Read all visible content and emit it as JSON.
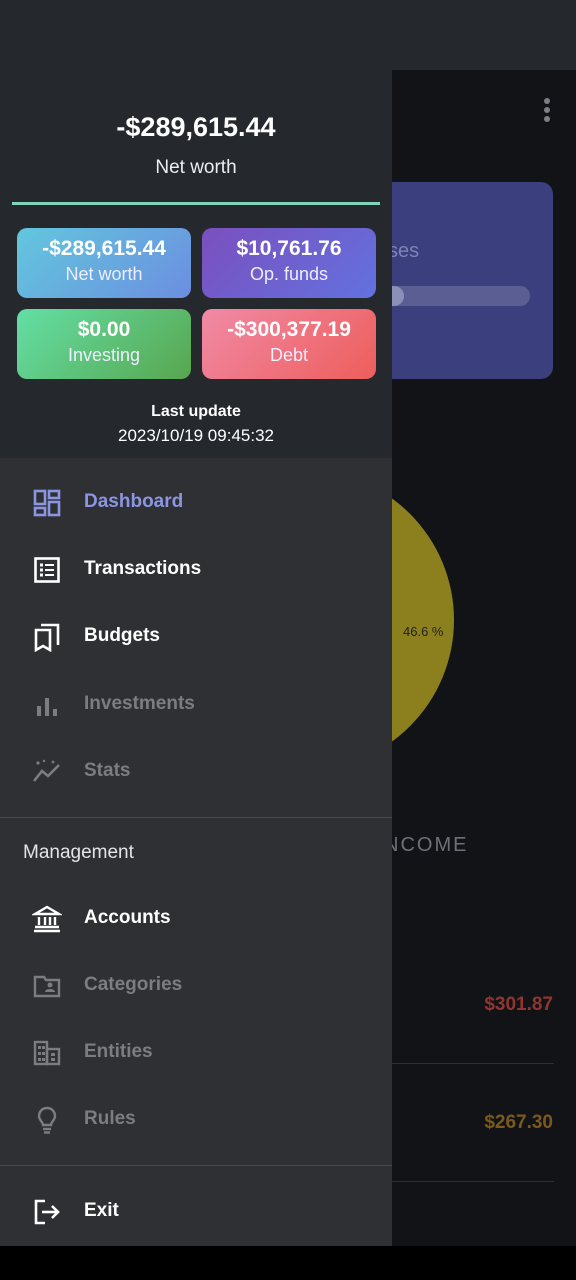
{
  "header": {
    "net_worth_value": "-$289,615.44",
    "net_worth_label": "Net worth",
    "tiles": [
      {
        "value": "-$289,615.44",
        "label": "Net worth"
      },
      {
        "value": "$10,761.76",
        "label": "Op. funds"
      },
      {
        "value": "$0.00",
        "label": "Investing"
      },
      {
        "value": "-$300,377.19",
        "label": "Debt"
      }
    ],
    "last_update_label": "Last update",
    "last_update_time": "2023/10/19 09:45:32"
  },
  "menu": {
    "items": [
      {
        "label": "Dashboard",
        "icon": "dashboard-icon"
      },
      {
        "label": "Transactions",
        "icon": "list-icon"
      },
      {
        "label": "Budgets",
        "icon": "bookmarks-icon"
      },
      {
        "label": "Investments",
        "icon": "bar-chart-icon"
      },
      {
        "label": "Stats",
        "icon": "trending-icon"
      }
    ],
    "management_title": "Management",
    "management_items": [
      {
        "label": "Accounts",
        "icon": "bank-icon"
      },
      {
        "label": "Categories",
        "icon": "folder-user-icon"
      },
      {
        "label": "Entities",
        "icon": "building-icon"
      },
      {
        "label": "Rules",
        "icon": "lightbulb-icon"
      }
    ],
    "exit_label": "Exit"
  },
  "background": {
    "card_label": "ses",
    "pie_label": "46.6 %",
    "income_title": "NCOME",
    "amounts": [
      "$301.87",
      "$267.30"
    ]
  },
  "colors": {
    "accent": "#8c95e2",
    "header_line": "#7fd5b6"
  }
}
